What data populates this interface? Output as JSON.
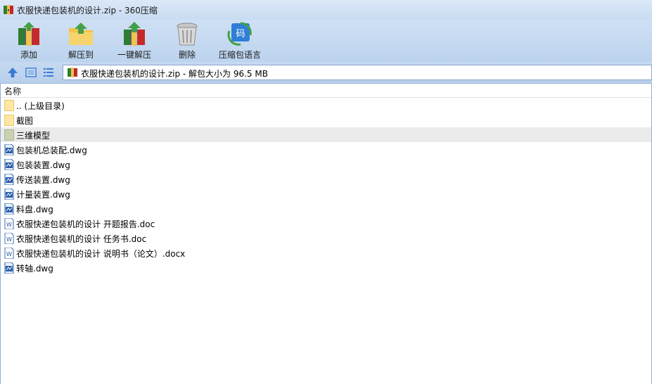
{
  "window": {
    "title": "衣服快递包装机的设计.zip - 360压缩"
  },
  "toolbar": {
    "buttons": [
      {
        "label": "添加",
        "icon": "add-archive-icon"
      },
      {
        "label": "解压到",
        "icon": "extract-to-icon"
      },
      {
        "label": "一键解压",
        "icon": "one-click-extract-icon"
      },
      {
        "label": "删除",
        "icon": "delete-trash-icon"
      },
      {
        "label": "压缩包语言",
        "icon": "archive-language-icon"
      }
    ]
  },
  "address": {
    "path": "衣服快递包装机的设计.zip - 解包大小为 96.5 MB"
  },
  "list": {
    "column_name": "名称",
    "items": [
      {
        "name": ".. (上级目录)",
        "type": "folder"
      },
      {
        "name": "截图",
        "type": "folder"
      },
      {
        "name": "三维模型",
        "type": "folder"
      },
      {
        "name": "包装机总装配.dwg",
        "type": "dwg"
      },
      {
        "name": "包装装置.dwg",
        "type": "dwg"
      },
      {
        "name": "传送装置.dwg",
        "type": "dwg"
      },
      {
        "name": "计量装置.dwg",
        "type": "dwg"
      },
      {
        "name": "料盘.dwg",
        "type": "dwg"
      },
      {
        "name": "衣服快递包装机的设计 开题报告.doc",
        "type": "doc"
      },
      {
        "name": "衣服快递包装机的设计 任务书.doc",
        "type": "doc"
      },
      {
        "name": "衣服快递包装机的设计 说明书（论文）.docx",
        "type": "doc"
      },
      {
        "name": "转轴.dwg",
        "type": "dwg"
      }
    ],
    "selected_index": 2
  },
  "colors": {
    "accent": "#3a7bd5",
    "selection": "#ebebeb",
    "toolbar_bg": "#c9dcf3"
  }
}
